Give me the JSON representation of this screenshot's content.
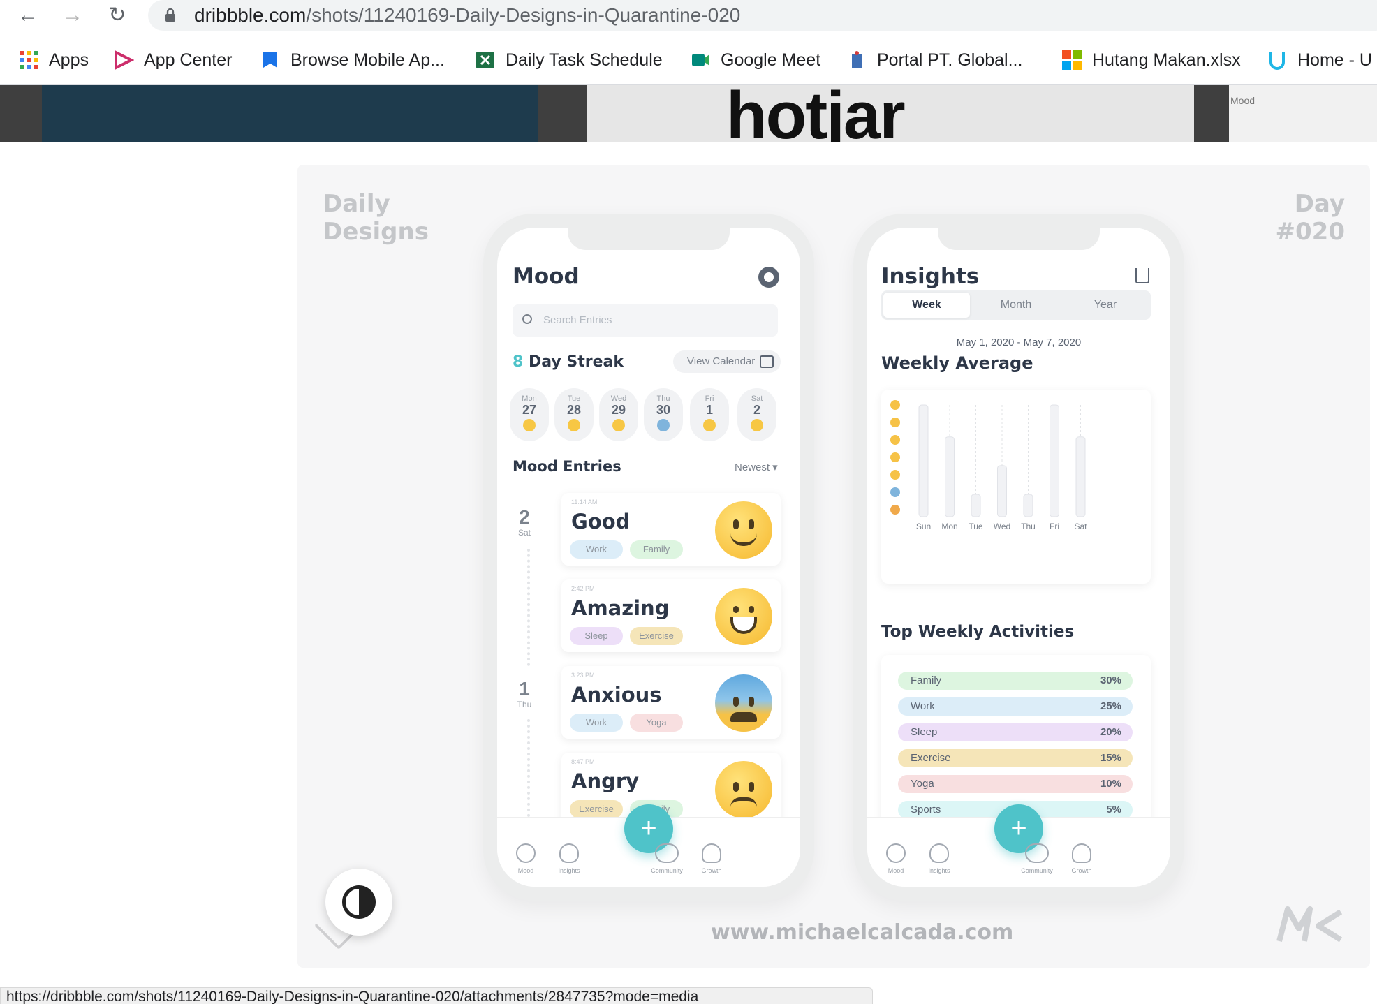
{
  "browser": {
    "url_domain": "dribbble.com",
    "url_path": "/shots/11240169-Daily-Designs-in-Quarantine-020",
    "status_url": "https://dribbble.com/shots/11240169-Daily-Designs-in-Quarantine-020/attachments/2847735?mode=media"
  },
  "bookmarks": [
    {
      "label": "Apps",
      "icon": "grid-icon"
    },
    {
      "label": "App Center",
      "icon": "app-center-icon"
    },
    {
      "label": "Browse Mobile Ap...",
      "icon": "bookmark-icon"
    },
    {
      "label": "Daily Task Schedule",
      "icon": "excel-icon"
    },
    {
      "label": "Google Meet",
      "icon": "meet-icon"
    },
    {
      "label": "Portal PT. Global...",
      "icon": "portal-icon"
    },
    {
      "label": "Hutang Makan.xlsx",
      "icon": "microsoft-icon"
    },
    {
      "label": "Home - U",
      "icon": "udemy-icon"
    }
  ],
  "background": {
    "hotjar_text": "hotjar",
    "side_label": "Mood"
  },
  "shot": {
    "corner_left": [
      "Daily",
      "Designs"
    ],
    "corner_right": [
      "Day",
      "#020"
    ],
    "website": "www.michaelcalcada.com"
  },
  "mood_screen": {
    "title": "Mood",
    "search_placeholder": "Search Entries",
    "streak_count": "8",
    "streak_label": "Day Streak",
    "view_calendar": "View Calendar",
    "days": [
      {
        "name": "Mon",
        "date": "27"
      },
      {
        "name": "Tue",
        "date": "28"
      },
      {
        "name": "Wed",
        "date": "29"
      },
      {
        "name": "Thu",
        "date": "30"
      },
      {
        "name": "Fri",
        "date": "1"
      },
      {
        "name": "Sat",
        "date": "2"
      }
    ],
    "entries_heading": "Mood Entries",
    "sort_label": "Newest ▾",
    "groups": [
      {
        "date": "2",
        "day": "Sat"
      },
      {
        "date": "1",
        "day": "Thu"
      }
    ],
    "entries": [
      {
        "time": "11:14 AM",
        "mood": "Good",
        "tags": [
          "Work",
          "Family"
        ]
      },
      {
        "time": "2:42 PM",
        "mood": "Amazing",
        "tags": [
          "Sleep",
          "Exercise"
        ]
      },
      {
        "time": "3:23 PM",
        "mood": "Anxious",
        "tags": [
          "Work",
          "Yoga"
        ]
      },
      {
        "time": "8:47 PM",
        "mood": "Angry",
        "tags": [
          "Exercise",
          "Family"
        ]
      }
    ]
  },
  "insights_screen": {
    "title": "Insights",
    "segments": [
      "Week",
      "Month",
      "Year"
    ],
    "date_range": "May 1, 2020 - May 7, 2020",
    "weekly_average": "Weekly Average",
    "top_activities": "Top Weekly Activities",
    "activities": [
      {
        "name": "Family",
        "pct": "30%",
        "color": "#ddf5e0"
      },
      {
        "name": "Work",
        "pct": "25%",
        "color": "#dcedf8"
      },
      {
        "name": "Sleep",
        "pct": "20%",
        "color": "#eddff8"
      },
      {
        "name": "Exercise",
        "pct": "15%",
        "color": "#f5e5b8"
      },
      {
        "name": "Yoga",
        "pct": "10%",
        "color": "#f8dfe0"
      },
      {
        "name": "Sports",
        "pct": "5%",
        "color": "#dcf6f6"
      }
    ]
  },
  "nav": [
    "Mood",
    "Insights",
    "Community",
    "Growth"
  ],
  "fab_label": "+",
  "chart_data": {
    "type": "bar",
    "categories": [
      "Sun",
      "Mon",
      "Tue",
      "Wed",
      "Thu",
      "Fri",
      "Sat"
    ],
    "values": [
      7,
      5,
      1.4,
      3.2,
      1.4,
      7,
      5
    ],
    "ylim": [
      0,
      7
    ],
    "y_axis": "mood emoji scale (7 levels)",
    "grid": "dashed vertical guides"
  },
  "colors": {
    "accent": "#4fc3c9",
    "text": "#2d3748"
  }
}
